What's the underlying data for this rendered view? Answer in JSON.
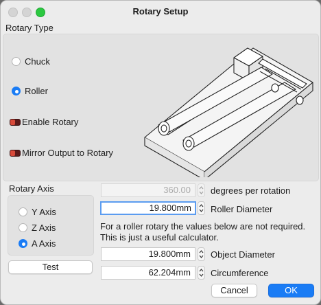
{
  "window": {
    "title": "Rotary Setup"
  },
  "rotary_type": {
    "label": "Rotary Type",
    "options": [
      {
        "label": "Chuck",
        "selected": false
      },
      {
        "label": "Roller",
        "selected": true
      }
    ],
    "toggles": [
      {
        "label": "Enable Rotary",
        "on": false
      },
      {
        "label": "Mirror Output to Rotary",
        "on": false
      }
    ],
    "illustration_icon": "roller-rotary-illustration"
  },
  "rotary_axis": {
    "label": "Rotary Axis",
    "options": [
      {
        "label": "Y Axis",
        "selected": false
      },
      {
        "label": "Z Axis",
        "selected": false
      },
      {
        "label": "A Axis",
        "selected": true
      }
    ],
    "test_label": "Test"
  },
  "fields": {
    "degrees_per_rotation": {
      "value": "360.00",
      "label": "degrees per rotation",
      "disabled": true
    },
    "roller_diameter": {
      "value": "19.800mm",
      "label": "Roller Diameter"
    },
    "note_line1": "For a roller rotary the values below are not required.",
    "note_line2": "This is just a useful calculator.",
    "object_diameter": {
      "value": "19.800mm",
      "label": "Object Diameter"
    },
    "circumference": {
      "value": "62.204mm",
      "label": "Circumference"
    }
  },
  "buttons": {
    "cancel": "Cancel",
    "ok": "OK"
  },
  "colors": {
    "accent": "#1a7cf5",
    "toggle_off": "#5c1a1a",
    "window_bg": "#ececec"
  }
}
